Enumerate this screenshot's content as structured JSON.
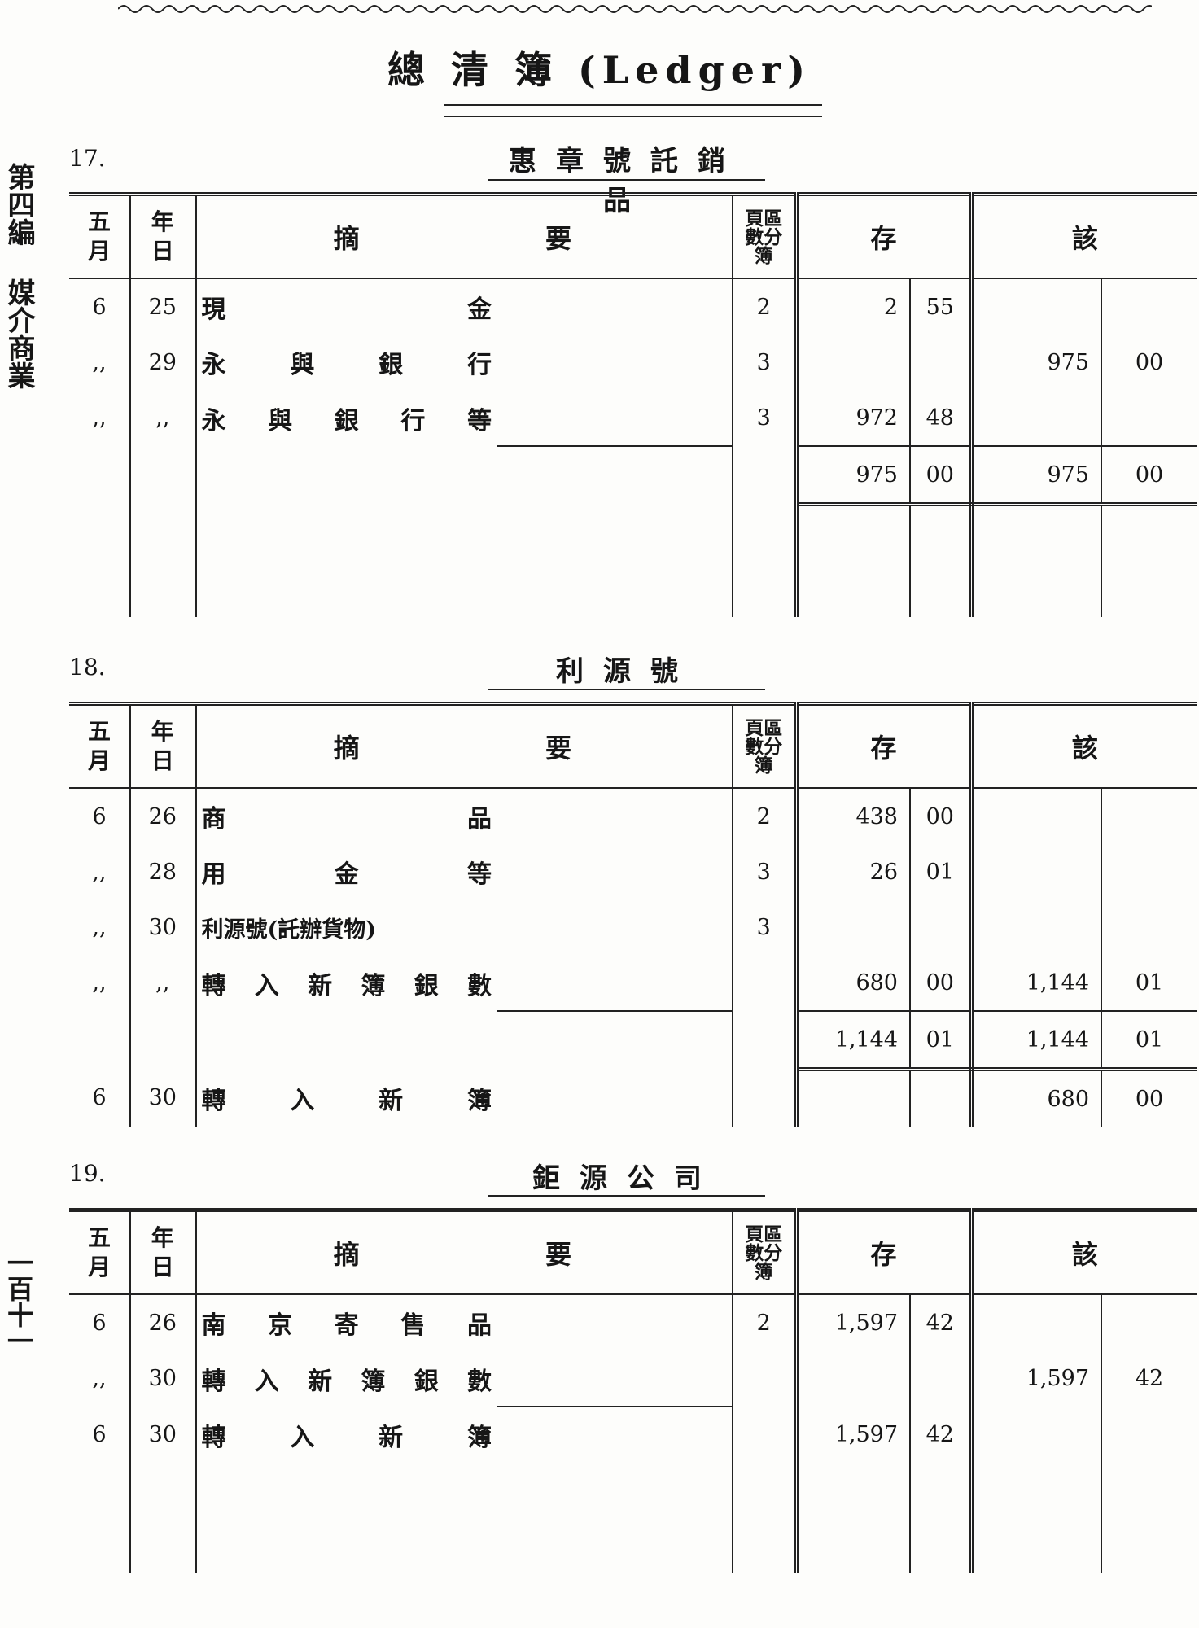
{
  "page": {
    "title": "總 清 簿 (Ledger)",
    "side_text_top": "第四編",
    "side_text_bottom": "媒介商業",
    "page_number": "一百十一"
  },
  "headers": {
    "month": "五\n月",
    "day": "年\n日",
    "desc_1": "摘",
    "desc_2": "要",
    "page_ref": "頁區\n數分\n簿",
    "credit": "存",
    "debit": "該"
  },
  "accounts": [
    {
      "number": "17.",
      "name": "惠章號託銷品",
      "rows": [
        {
          "month": "6",
          "day": "25",
          "desc": "現金",
          "page": "2",
          "credit": "2",
          "credit_cents": "55",
          "debit": "",
          "debit_cents": ""
        },
        {
          "month": ",,",
          "day": "29",
          "desc": "永與銀行",
          "page": "3",
          "credit": "",
          "credit_cents": "",
          "debit": "975",
          "debit_cents": "00"
        },
        {
          "month": ",,",
          "day": ",,",
          "desc": "永與銀行等",
          "page": "3",
          "credit": "972",
          "credit_cents": "48",
          "debit": "",
          "debit_cents": ""
        }
      ],
      "total": {
        "credit": "975",
        "credit_cents": "00",
        "debit": "975",
        "debit_cents": "00"
      }
    },
    {
      "number": "18.",
      "name": "利源號",
      "rows": [
        {
          "month": "6",
          "day": "26",
          "desc": "商品",
          "page": "2",
          "credit": "438",
          "credit_cents": "00",
          "debit": "",
          "debit_cents": ""
        },
        {
          "month": ",,",
          "day": "28",
          "desc": "用金等",
          "page": "3",
          "credit": "26",
          "credit_cents": "01",
          "debit": "",
          "debit_cents": ""
        },
        {
          "month": ",,",
          "day": "30",
          "desc": "利源號(託辦貨物)",
          "page": "3",
          "credit": "",
          "credit_cents": "",
          "debit": "",
          "debit_cents": ""
        },
        {
          "month": ",,",
          "day": ",,",
          "desc": "轉入新簿銀數",
          "page": "",
          "credit": "680",
          "credit_cents": "00",
          "debit": "1,144",
          "debit_cents": "01"
        }
      ],
      "total": {
        "credit": "1,144",
        "credit_cents": "01",
        "debit": "1,144",
        "debit_cents": "01"
      },
      "carry": {
        "month": "6",
        "day": "30",
        "desc": "轉入新簿",
        "credit": "",
        "credit_cents": "",
        "debit": "680",
        "debit_cents": "00"
      }
    },
    {
      "number": "19.",
      "name": "鉅源公司",
      "rows": [
        {
          "month": "6",
          "day": "26",
          "desc": "南京寄售品",
          "page": "2",
          "credit": "1,597",
          "credit_cents": "42",
          "debit": "",
          "debit_cents": ""
        },
        {
          "month": ",,",
          "day": "30",
          "desc": "轉入新簿銀數",
          "page": "",
          "credit": "",
          "credit_cents": "",
          "debit": "1,597",
          "debit_cents": "42"
        }
      ],
      "carry": {
        "month": "6",
        "day": "30",
        "desc": "轉入新簿",
        "credit": "1,597",
        "credit_cents": "42",
        "debit": "",
        "debit_cents": ""
      }
    }
  ]
}
